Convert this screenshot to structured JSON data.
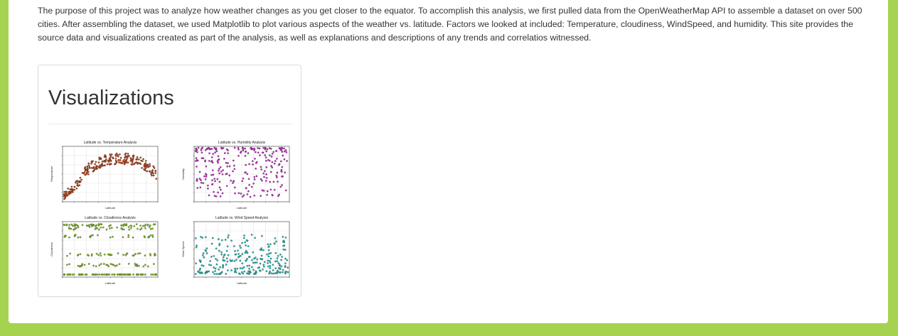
{
  "intro": {
    "text": "The purpose of this project was to analyze how weather changes as you get closer to the equator. To accomplish this analysis, we first pulled data from the OpenWeatherMap API to assemble a dataset on over 500 cities. After assembling the dataset, we used Matplotlib to plot various aspects of the weather vs. latitude. Factors we looked at included: Temperature, cloudiness, WindSpeed, and humidity. This site provides the source data and visualizations created as part of the analysis, as well as explanations and descriptions of any trends and correlatios witnessed."
  },
  "visualizations": {
    "heading": "Visualizations",
    "thumbnails": [
      {
        "title": "Latitude vs. Temperature Analysis",
        "xlabel": "Latitude",
        "ylabel": "Temperature",
        "color": "#b5431a",
        "kind": "temperature"
      },
      {
        "title": "Latitude vs. Humidity Analysis",
        "xlabel": "Latitude",
        "ylabel": "Humidity",
        "color": "#c02cc0",
        "kind": "humidity"
      },
      {
        "title": "Latitude vs. Cloudiness Analysis",
        "xlabel": "Latitude",
        "ylabel": "Cloudiness",
        "color": "#7fb51f",
        "kind": "cloudiness"
      },
      {
        "title": "Latitude vs. Wind Speed Analysis",
        "xlabel": "Latitude",
        "ylabel": "Wind Speed",
        "color": "#1fb5b0",
        "kind": "wind"
      }
    ]
  },
  "colors": {
    "page_background": "#a6d34f",
    "card_background": "#ffffff",
    "text": "#333333"
  }
}
